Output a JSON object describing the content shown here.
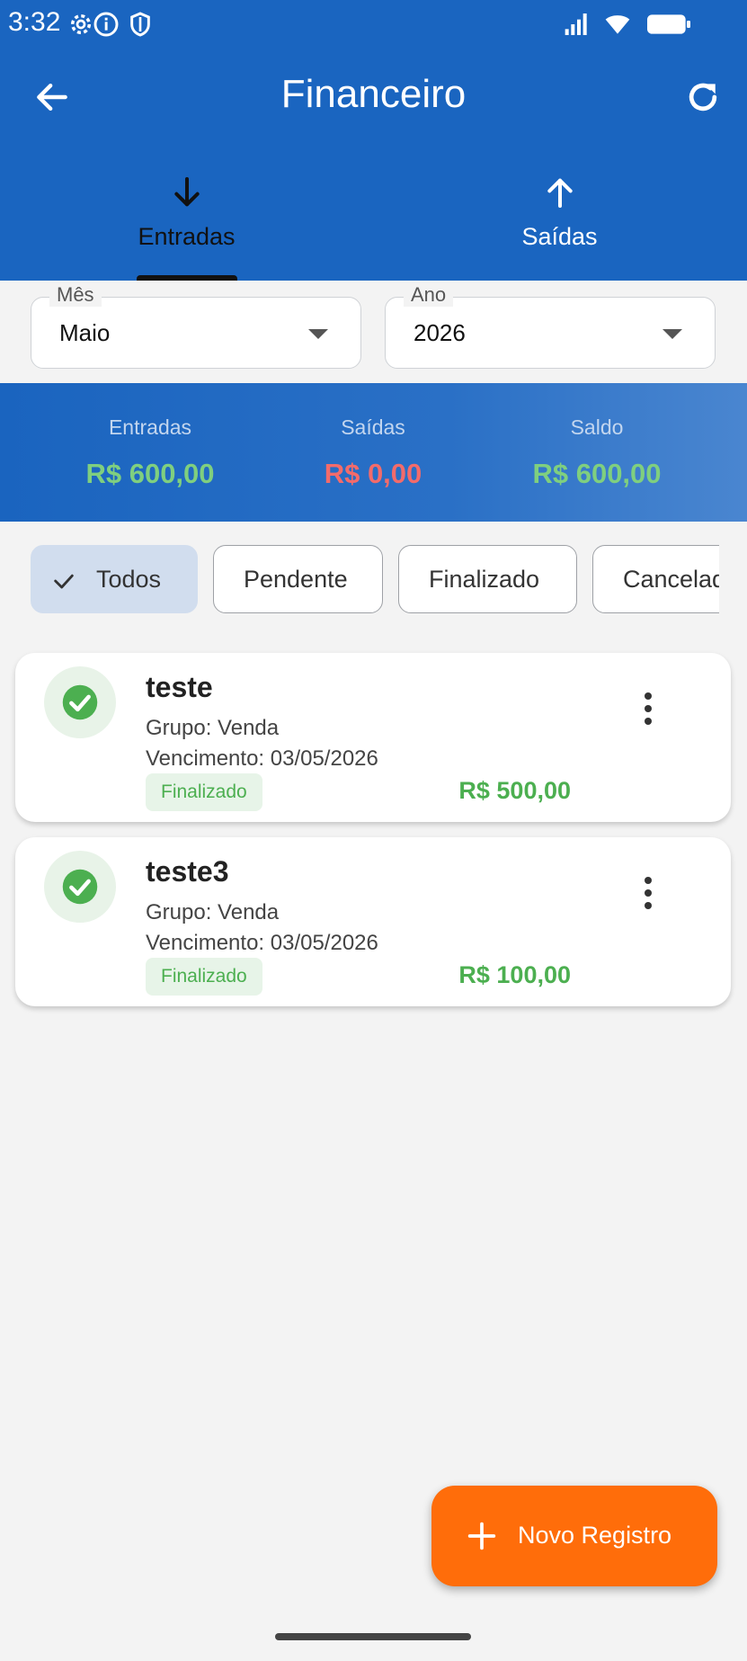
{
  "status_bar": {
    "time": "3:32",
    "icons": [
      "gear-icon",
      "info-icon",
      "shield-icon",
      "signal-icon",
      "wifi-icon",
      "battery-icon"
    ]
  },
  "app_bar": {
    "title": "Financeiro",
    "back_icon": "arrow-back-icon",
    "refresh_icon": "refresh-icon"
  },
  "tabs": [
    {
      "label": "Entradas",
      "icon": "arrow-down-icon",
      "selected": true
    },
    {
      "label": "Saídas",
      "icon": "arrow-up-icon",
      "selected": false
    }
  ],
  "filters": {
    "month": {
      "label": "Mês",
      "value": "Maio"
    },
    "year": {
      "label": "Ano",
      "value": "2026"
    }
  },
  "summary": {
    "entradas": {
      "label": "Entradas",
      "value": "R$ 600,00"
    },
    "saidas": {
      "label": "Saídas",
      "value": "R$ 0,00"
    },
    "saldo": {
      "label": "Saldo",
      "value": "R$ 600,00"
    }
  },
  "status_chips": [
    {
      "label": "Todos",
      "selected": true
    },
    {
      "label": "Pendente",
      "selected": false
    },
    {
      "label": "Finalizado",
      "selected": false
    },
    {
      "label": "Cancelado",
      "selected": false
    }
  ],
  "records": [
    {
      "title": "teste",
      "group": "Grupo: Venda",
      "due": "Vencimento: 03/05/2026",
      "status": "Finalizado",
      "amount": "R$ 500,00"
    },
    {
      "title": "teste3",
      "group": "Grupo: Venda",
      "due": "Vencimento: 03/05/2026",
      "status": "Finalizado",
      "amount": "R$ 100,00"
    }
  ],
  "fab": {
    "label": "Novo Registro",
    "icon": "plus-icon"
  },
  "colors": {
    "primary": "#1a65c0",
    "income_green": "#4caf50",
    "summary_green": "#7fcf7f",
    "expense_red": "#f26b6b",
    "fab_orange": "#ff6d0a",
    "chip_selected": "#d1ddee"
  }
}
